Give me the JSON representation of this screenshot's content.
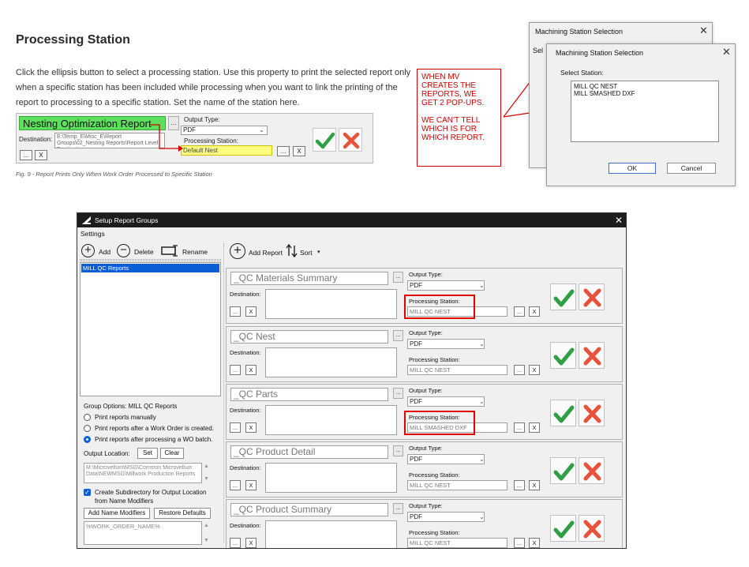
{
  "doc": {
    "title": "Processing Station",
    "paragraph_lines": [
      "Click the ellipsis button to select a processing station. Use this property to print the selected report only",
      "when a specific station has been included while processing when you want to link the printing of the",
      "report to processing to a specific station. Set the name of the station here."
    ],
    "figure": {
      "report_name": "Nesting Optimization Report",
      "ellipsis": "...",
      "destination_label": "Destination:",
      "destination_value": "E:\\Temp_E\\Misc_E\\Report Groups\\02_Nesting Reports\\Report Level Destination",
      "output_type_label": "Output Type:",
      "output_type_value": "PDF",
      "processing_station_label": "Processing Station:",
      "processing_station_value": "Default Nest",
      "clear_x": "X",
      "accent_green": "#5de05d",
      "highlight_yellow": "#ffff80"
    },
    "caption": "Fig. 9 - Report Prints Only When Work Order Processed to Specific Station"
  },
  "callout": {
    "lines": [
      "WHEN MV",
      "CREATES THE",
      "REPORTS, WE",
      "GET 2 POP-UPS.",
      "",
      "WE CAN'T TELL",
      "WHICH IS FOR",
      "WHICH REPORT."
    ],
    "color": "#d00000"
  },
  "popup_back": {
    "title": "Machining Station Selection",
    "partial_label": "Sel",
    "close": "✕"
  },
  "popup_front": {
    "title": "Machining Station Selection",
    "close": "✕",
    "select_label": "Select Station:",
    "stations": [
      "MILL QC NEST",
      "MILL SMASHED DXF"
    ],
    "ok": "OK",
    "cancel": "Cancel"
  },
  "window": {
    "title": "Setup Report Groups",
    "close": "✕",
    "menu": {
      "settings": "Settings"
    },
    "toolbar": {
      "add": "Add",
      "delete": "Delete",
      "rename": "Rename",
      "add_report": "Add Report",
      "sort": "Sort"
    },
    "groups": [
      "MILL QC Reports"
    ],
    "group_options": {
      "title": "Group Options: MILL QC Reports",
      "options": [
        "Print reports manually",
        "Print reports after a Work Order is created.",
        "Print reports after processing a WO batch."
      ],
      "selected_index": 2
    },
    "output_location": {
      "label": "Output Location:",
      "set": "Set",
      "clear": "Clear",
      "path": "M:\\Microvellum\\MSG\\Common Microvellum Data\\NEWMSG\\Millwork Production Reports"
    },
    "subdirectory_checkbox": "Create Subdirectory for Output Location",
    "subdirectory_checkbox_line2": "from Name Modifiers",
    "add_name_modifiers": "Add Name Modifiers",
    "restore_defaults": "Restore Defaults",
    "name_modifier": "%WORK_ORDER_NAME%",
    "labels": {
      "output_type": "Output Type:",
      "destination": "Destination:",
      "processing_station": "Processing Station:",
      "ellipsis": "...",
      "x": "X"
    },
    "reports": [
      {
        "name": "_QC Materials Summary",
        "output_type": "PDF",
        "station": "MILL QC NEST"
      },
      {
        "name": "_QC Nest",
        "output_type": "PDF",
        "station": "MILL QC NEST"
      },
      {
        "name": "_QC Parts",
        "output_type": "PDF",
        "station": "MILL SMASHED DXF"
      },
      {
        "name": "_QC Product Detail",
        "output_type": "PDF",
        "station": "MILL QC NEST"
      },
      {
        "name": "_QC Product Summary",
        "output_type": "PDF",
        "station": "MILL QC NEST"
      }
    ],
    "accent_blue": "#0a5fd8",
    "ok_green": "#2ea043",
    "cancel_red": "#e8523a",
    "highlight_red": "#e00000"
  }
}
